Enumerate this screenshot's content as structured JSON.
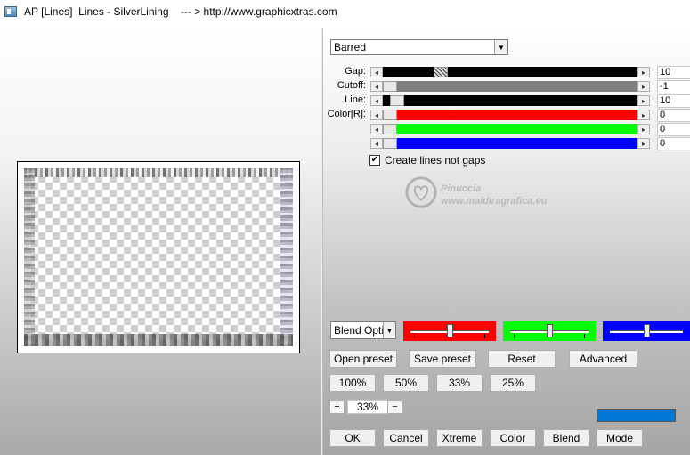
{
  "window": {
    "title": "AP [Lines]  Lines - SilverLining    --- > http://www.graphicxtras.com"
  },
  "controls": {
    "style_select": {
      "value": "Barred"
    },
    "sliders": [
      {
        "label": "Gap:",
        "value": "10",
        "track_color": "#000000",
        "fill_fraction": 0.21
      },
      {
        "label": "Cutoff:",
        "value": "-1",
        "track_color": "#808080",
        "fill_fraction": 0.0
      },
      {
        "label": "Line:",
        "value": "10",
        "track_color": "#000000",
        "fill_fraction": 0.03
      },
      {
        "label": "Color[R]:",
        "value": "0",
        "track_color": "#ff0000",
        "fill_fraction": 0.0
      },
      {
        "label": "",
        "value": "0",
        "track_color": "#00ff00",
        "fill_fraction": 0.0
      },
      {
        "label": "",
        "value": "0",
        "track_color": "#0000ff",
        "fill_fraction": 0.0
      }
    ],
    "checkbox": {
      "label": "Create lines not gaps",
      "checked": true
    }
  },
  "watermark": {
    "line1": "Pinuccia",
    "line2": "www.maidiragrafica.eu"
  },
  "blend": {
    "select_value": "Blend Optio",
    "red_level": 0.5,
    "green_level": 0.5,
    "blue_level": 0.5,
    "colors": {
      "red": "#ff0000",
      "green": "#00ff00",
      "blue": "#0000ff"
    }
  },
  "buttons": {
    "open_preset": "Open preset",
    "save_preset": "Save preset",
    "reset": "Reset",
    "advanced": "Advanced",
    "z100": "100%",
    "z50": "50%",
    "z33": "33%",
    "z25": "25%",
    "plus": "+",
    "minus": "−",
    "ok": "OK",
    "cancel": "Cancel",
    "xtreme": "Xtreme",
    "color": "Color",
    "blend": "Blend",
    "mode": "Mode"
  },
  "zoom": {
    "value": "33%"
  },
  "accent_color": "#0078d7"
}
